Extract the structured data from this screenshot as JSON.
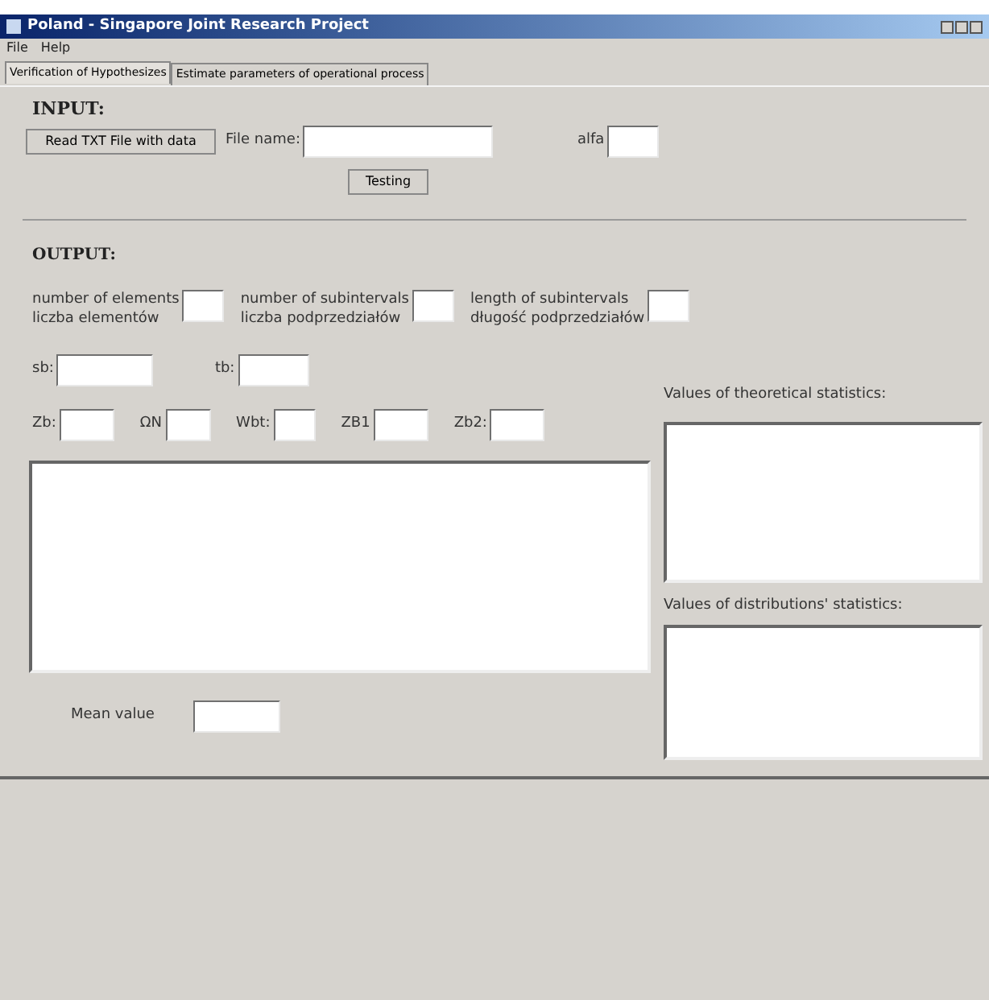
{
  "window": {
    "title": "Poland - Singapore Joint Research Project"
  },
  "menu": [
    "File",
    "Help"
  ],
  "tabs": [
    {
      "label": "Verification of Hypothesizes",
      "selected": true
    },
    {
      "label": "Estimate parameters of operational process",
      "selected": false
    }
  ],
  "input": {
    "heading": "INPUT:",
    "read_button": "Read TXT File with data",
    "file_name_label": "File name:",
    "alfa_label": "alfa",
    "testing_button": "Testing"
  },
  "output": {
    "heading": "OUTPUT:",
    "counts": [
      {
        "label": "number of elements",
        "sublabel": "liczba elementów"
      },
      {
        "label": "number of subintervals",
        "sublabel": "liczba podprzedziałów"
      },
      {
        "label": "length of subintervals",
        "sublabel": "długość podprzedziałów"
      }
    ],
    "row1": [
      "sb:",
      "tb:"
    ],
    "row2": [
      "Zb:",
      "ΩN",
      "Wbt:",
      "ZB1",
      "Zb2:"
    ],
    "theoretical_label": "Values of theoretical statistics:",
    "distribution_label": "Values of distributions' statistics:",
    "mean_label": "Mean value"
  }
}
